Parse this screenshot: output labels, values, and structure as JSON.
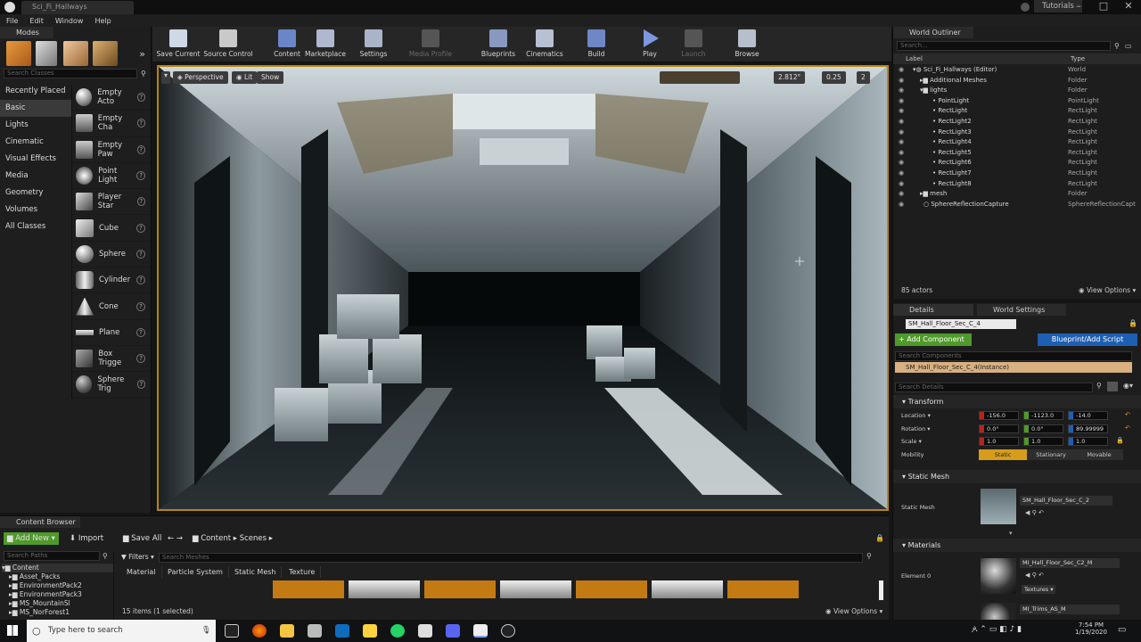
{
  "window": {
    "tab_title": "Sci_Fi_Hallways",
    "right_label": "Tutorials"
  },
  "menu": [
    "File",
    "Edit",
    "Window",
    "Help"
  ],
  "modes": {
    "tab_label": "Modes",
    "search_placeholder": "Search Classes",
    "categories": [
      "Recently Placed",
      "Basic",
      "Lights",
      "Cinematic",
      "Visual Effects",
      "Media",
      "Geometry",
      "Volumes",
      "All Classes"
    ],
    "items": [
      "Empty Acto",
      "Empty Cha",
      "Empty Paw",
      "Point Light",
      "Player Star",
      "Cube",
      "Sphere",
      "Cylinder",
      "Cone",
      "Plane",
      "Box Trigge",
      "Sphere Trig"
    ]
  },
  "toolbar": {
    "buttons": [
      {
        "label": "Save Current",
        "color": "#cfd8e6"
      },
      {
        "label": "Source Control",
        "color": "#c9c9c9"
      },
      {
        "label": "Content",
        "color": "#6b86c8"
      },
      {
        "label": "Marketplace",
        "color": "#b0b8d0"
      },
      {
        "label": "Settings",
        "color": "#aab4c8"
      },
      {
        "label": "Media Profile",
        "color": "#555555"
      },
      {
        "label": "Blueprints",
        "color": "#8898c0"
      },
      {
        "label": "Cinematics",
        "color": "#b8c0d4"
      },
      {
        "label": "Build",
        "color": "#6f87c6"
      },
      {
        "label": "Play",
        "color": "#7d98e0"
      },
      {
        "label": "Launch",
        "color": "#555555"
      },
      {
        "label": "Browse",
        "color": "#b8bfcc"
      }
    ]
  },
  "viewport": {
    "perspective": "Perspective",
    "lit": "Lit",
    "show": "Show",
    "fov": "2.812°",
    "scale": "0.25",
    "grid": "2"
  },
  "outliner": {
    "tab_label": "World Outliner",
    "search_placeholder": "Search...",
    "col_label": "Label",
    "col_type": "Type",
    "rows": [
      {
        "label": "Sci_Fi_Hallways (Editor)",
        "type": "World",
        "indent": 0
      },
      {
        "label": "Additional Meshes",
        "type": "Folder",
        "indent": 1
      },
      {
        "label": "lights",
        "type": "Folder",
        "indent": 1
      },
      {
        "label": "PointLight",
        "type": "PointLight",
        "indent": 2
      },
      {
        "label": "RectLight",
        "type": "RectLight",
        "indent": 2
      },
      {
        "label": "RectLight2",
        "type": "RectLight",
        "indent": 2
      },
      {
        "label": "RectLight3",
        "type": "RectLight",
        "indent": 2
      },
      {
        "label": "RectLight4",
        "type": "RectLight",
        "indent": 2
      },
      {
        "label": "RectLight5",
        "type": "RectLight",
        "indent": 2
      },
      {
        "label": "RectLight6",
        "type": "RectLight",
        "indent": 2
      },
      {
        "label": "RectLight7",
        "type": "RectLight",
        "indent": 2
      },
      {
        "label": "RectLight8",
        "type": "RectLight",
        "indent": 2
      },
      {
        "label": "mesh",
        "type": "Folder",
        "indent": 1
      },
      {
        "label": "SphereReflectionCapture",
        "type": "SphereReflectionCapt",
        "indent": 1
      }
    ],
    "actor_count": "85 actors",
    "view_options": "View Options"
  },
  "details": {
    "tab_details": "Details",
    "tab_world_settings": "World Settings",
    "actor_name": "SM_Hall_Floor_Sec_C_4",
    "add_component": "+ Add Component",
    "blueprint_script": "Blueprint/Add Script",
    "search_components": "Search Components",
    "instance_label": "SM_Hall_Floor_Sec_C_4(Instance)",
    "search_details": "Search Details",
    "transform_header": "Transform",
    "location_label": "Location",
    "rotation_label": "Rotation",
    "scale_label": "Scale",
    "mobility_label": "Mobility",
    "location": [
      "-156.0",
      "-1123.0",
      "-14.0"
    ],
    "rotation": [
      "0.0°",
      "0.0°",
      "89.99999"
    ],
    "scale": [
      "1.0",
      "1.0",
      "1.0"
    ],
    "mobility": [
      "Static",
      "Stationary",
      "Movable"
    ],
    "static_mesh_header": "Static Mesh",
    "static_mesh_label": "Static Mesh",
    "static_mesh_value": "SM_Hall_Floor_Sec_C_2",
    "materials_header": "Materials",
    "element_label": "Element 0",
    "material_value": "MI_Hall_Floor_Sec_C2_M",
    "textures_label": "Textures",
    "material2_value": "MI_Trims_AS_M"
  },
  "content_browser": {
    "tab_label": "Content Browser",
    "add_new": "Add New",
    "import": "Import",
    "save_all": "Save All",
    "path": [
      "Content",
      "Scenes"
    ],
    "search_paths": "Search Paths",
    "search_meshes": "Search Meshes",
    "filters": "Filters",
    "filter_tabs": [
      "Material",
      "Particle System",
      "Static Mesh",
      "Texture"
    ],
    "tree": [
      "Content",
      "Asset_Packs",
      "EnvironmentPack2",
      "EnvironmentPack3",
      "MS_MountainSl",
      "MS_NorForest1"
    ],
    "status": "15 items (1 selected)",
    "view_options": "View Options"
  },
  "taskbar": {
    "search_placeholder": "Type here to search",
    "time": "7:54 PM",
    "date": "1/19/2020"
  },
  "colors": {
    "accent_green": "#4f9a2a",
    "accent_blue": "#1e5fb4",
    "viewport_border": "#b8860b",
    "static_yellow": "#d69c1a"
  }
}
